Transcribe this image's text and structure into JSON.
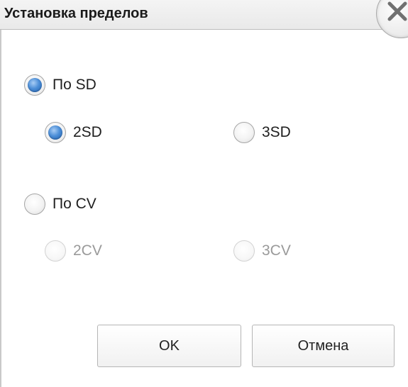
{
  "dialog": {
    "title": "Установка пределов",
    "close_icon": "close-icon"
  },
  "options": {
    "by_sd": {
      "label": "По SD",
      "checked": true,
      "sub": [
        {
          "label": "2SD",
          "checked": true,
          "disabled": false
        },
        {
          "label": "3SD",
          "checked": false,
          "disabled": false
        }
      ]
    },
    "by_cv": {
      "label": "По CV",
      "checked": false,
      "sub": [
        {
          "label": "2CV",
          "checked": false,
          "disabled": true
        },
        {
          "label": "3CV",
          "checked": false,
          "disabled": true
        }
      ]
    }
  },
  "buttons": {
    "ok_label": "OK",
    "cancel_label": "Отмена"
  },
  "colors": {
    "radio_selected": "#3a7fd0",
    "disabled_text": "#9a9a9a",
    "title_bar": "#ececec"
  }
}
